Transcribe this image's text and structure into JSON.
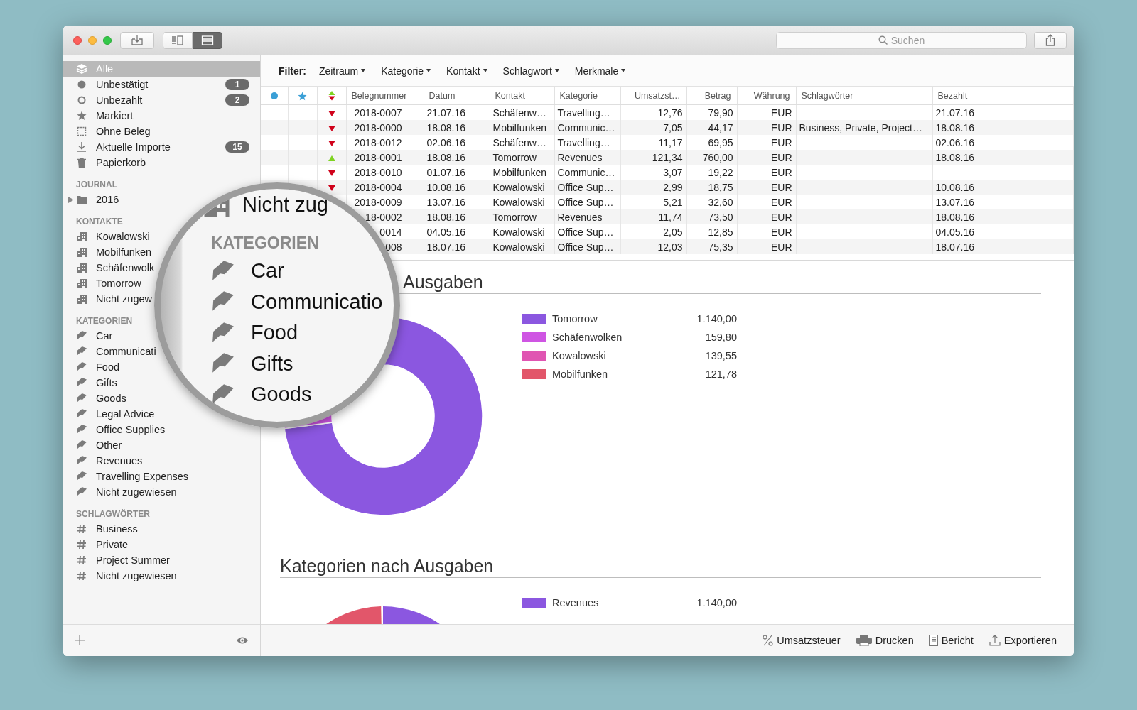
{
  "toolbar": {
    "view_modes": [
      {
        "kind": "columns",
        "selected": false
      },
      {
        "kind": "list",
        "selected": true
      }
    ],
    "search": {
      "placeholder": "Suchen"
    }
  },
  "sidebar": {
    "items": [
      {
        "kind": "all",
        "label": "Alle",
        "selected": true
      },
      {
        "kind": "unconfirmed",
        "label": "Unbestätigt",
        "badge": "1",
        "selected": false
      },
      {
        "kind": "unpaid",
        "label": "Unbezahlt",
        "badge": "2",
        "selected": false
      },
      {
        "kind": "flagged",
        "label": "Markiert",
        "selected": false
      },
      {
        "kind": "no-receipt",
        "label": "Ohne Beleg",
        "selected": false
      },
      {
        "kind": "imports",
        "label": "Aktuelle Importe",
        "badge": "15",
        "selected": false
      },
      {
        "kind": "trash",
        "label": "Papierkorb",
        "selected": false
      }
    ],
    "sections": [
      {
        "kind": "journal",
        "title": "JOURNAL",
        "items": [
          {
            "label": "2016",
            "expanded": false,
            "selected": false
          }
        ]
      },
      {
        "kind": "contacts",
        "title": "KONTAKTE",
        "items": [
          {
            "label": "Kowalowski",
            "selected": false
          },
          {
            "label": "Mobilfunken",
            "selected": false
          },
          {
            "label": "Schäfenwolk",
            "selected": false
          },
          {
            "label": "Tomorrow",
            "selected": false
          },
          {
            "label": "Nicht zugew",
            "selected": false
          }
        ]
      },
      {
        "kind": "categories",
        "title": "KATEGORIEN",
        "items": [
          {
            "label": "Car",
            "selected": false
          },
          {
            "label": "Communicati",
            "selected": false
          },
          {
            "label": "Food",
            "selected": false
          },
          {
            "label": "Gifts",
            "selected": false
          },
          {
            "label": "Goods",
            "selected": false
          },
          {
            "label": "Legal Advice",
            "selected": false
          },
          {
            "label": "Office Supplies",
            "selected": false
          },
          {
            "label": "Other",
            "selected": false
          },
          {
            "label": "Revenues",
            "selected": false
          },
          {
            "label": "Travelling Expenses",
            "selected": false
          },
          {
            "label": "Nicht zugewiesen",
            "selected": false
          }
        ]
      },
      {
        "kind": "tags",
        "title": "SCHLAGWÖRTER",
        "items": [
          {
            "label": "Business",
            "selected": false
          },
          {
            "label": "Private",
            "selected": false
          },
          {
            "label": "Project Summer",
            "selected": false
          },
          {
            "label": "Nicht zugewiesen",
            "selected": false
          }
        ]
      }
    ]
  },
  "filter": {
    "label": "Filter:",
    "options": [
      "Zeitraum",
      "Kategorie",
      "Kontakt",
      "Schlagwort",
      "Merkmale"
    ]
  },
  "table": {
    "columns": [
      {
        "kind": "status"
      },
      {
        "kind": "flag"
      },
      {
        "kind": "direction"
      },
      {
        "label": "Belegnummer"
      },
      {
        "label": "Datum"
      },
      {
        "label": "Kontakt"
      },
      {
        "label": "Kategorie"
      },
      {
        "label": "Umsatzst…"
      },
      {
        "label": "Betrag"
      },
      {
        "label": "Währung"
      },
      {
        "label": "Schlagwörter"
      },
      {
        "label": "Bezahlt"
      }
    ],
    "rows": [
      {
        "kind": "expense",
        "number": "2018-0007",
        "date": "21.07.16",
        "contact": "Schäfenw…",
        "category": "Travelling…",
        "tax": "12,76",
        "amount": "79,90",
        "currency": "EUR",
        "paid": "21.07.16"
      },
      {
        "kind": "expense",
        "number": "2018-0000",
        "date": "18.08.16",
        "contact": "Mobilfunken",
        "category": "Communic…",
        "tax": "7,05",
        "amount": "44,17",
        "currency": "EUR",
        "tags": "Business, Private, Project…",
        "paid": "18.08.16"
      },
      {
        "kind": "expense",
        "number": "2018-0012",
        "date": "02.06.16",
        "contact": "Schäfenw…",
        "category": "Travelling…",
        "tax": "11,17",
        "amount": "69,95",
        "currency": "EUR",
        "paid": "02.06.16"
      },
      {
        "kind": "income",
        "number": "2018-0001",
        "date": "18.08.16",
        "contact": "Tomorrow",
        "category": "Revenues",
        "tax": "121,34",
        "amount": "760,00",
        "currency": "EUR",
        "paid": "18.08.16"
      },
      {
        "kind": "expense",
        "number": "2018-0010",
        "date": "01.07.16",
        "contact": "Mobilfunken",
        "category": "Communic…",
        "tax": "3,07",
        "amount": "19,22",
        "currency": "EUR"
      },
      {
        "kind": "expense",
        "number": "2018-0004",
        "date": "10.08.16",
        "contact": "Kowalowski",
        "category": "Office Sup…",
        "tax": "2,99",
        "amount": "18,75",
        "currency": "EUR",
        "paid": "10.08.16"
      },
      {
        "number": "2018-0009",
        "date": "13.07.16",
        "contact": "Kowalowski",
        "category": "Office Sup…",
        "tax": "5,21",
        "amount": "32,60",
        "currency": "EUR",
        "paid": "13.07.16"
      },
      {
        "number": "18-0002",
        "date": "18.08.16",
        "contact": "Tomorrow",
        "category": "Revenues",
        "tax": "11,74",
        "amount": "73,50",
        "currency": "EUR",
        "paid": "18.08.16"
      },
      {
        "number": "0014",
        "date": "04.05.16",
        "contact": "Kowalowski",
        "category": "Office Sup…",
        "tax": "2,05",
        "amount": "12,85",
        "currency": "EUR",
        "paid": "04.05.16"
      },
      {
        "number": "008",
        "date": "18.07.16",
        "contact": "Kowalowski",
        "category": "Office Sup…",
        "tax": "12,03",
        "amount": "75,35",
        "currency": "EUR",
        "paid": "18.07.16"
      }
    ]
  },
  "charts": [
    {
      "kind": "donut",
      "title": "Ausgaben",
      "legend": [
        {
          "label": "Tomorrow",
          "value": "1.140,00",
          "color": "#8b57e0"
        },
        {
          "label": "Schäfenwolken",
          "value": "159,80",
          "color": "#cf55e3"
        },
        {
          "label": "Kowalowski",
          "value": "139,55",
          "color": "#e055b2"
        },
        {
          "label": "Mobilfunken",
          "value": "121,78",
          "color": "#e2566a"
        }
      ]
    },
    {
      "kind": "pie",
      "title": "Kategorien nach Ausgaben",
      "legend": [
        {
          "label": "Revenues",
          "value": "1.140,00",
          "color": "#8b57e0"
        }
      ]
    }
  ],
  "footer": {
    "actions": [
      {
        "kind": "tax",
        "label": "Umsatzsteuer"
      },
      {
        "kind": "print",
        "label": "Drucken"
      },
      {
        "kind": "report",
        "label": "Bericht"
      },
      {
        "kind": "export",
        "label": "Exportieren"
      }
    ]
  },
  "magnifier": {
    "contact": "Nicht zug",
    "section": "KATEGORIEN",
    "items": [
      "Car",
      "Communicatio",
      "Food",
      "Gifts",
      "Goods"
    ]
  }
}
